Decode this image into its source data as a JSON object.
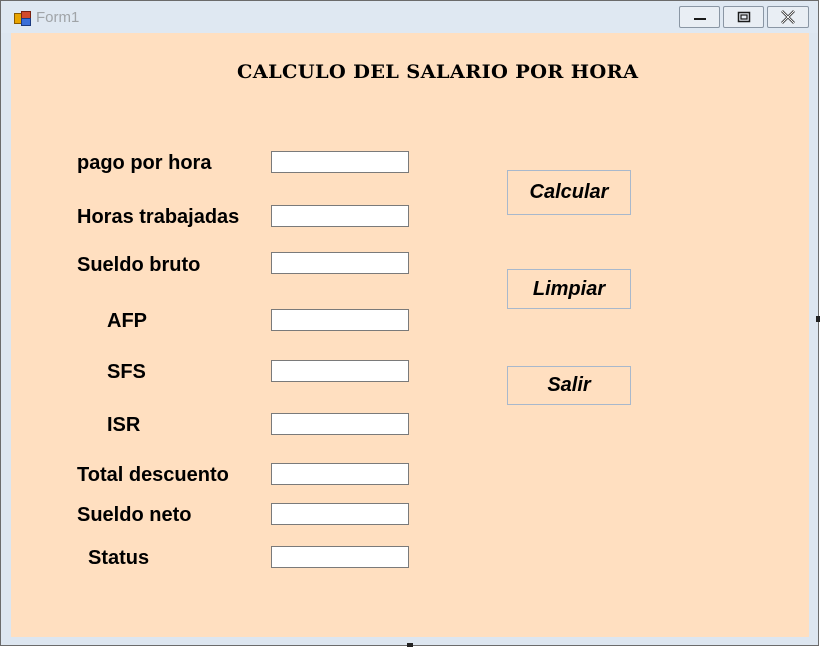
{
  "window": {
    "title": "Form1",
    "controls": {
      "minimize": "minimize",
      "maximize": "maximize",
      "close": "close"
    }
  },
  "form": {
    "heading": "CALCULO DEL SALARIO POR HORA",
    "background": "#ffdfc0",
    "fields": [
      {
        "label": "pago por hora",
        "value": ""
      },
      {
        "label": "Horas trabajadas",
        "value": ""
      },
      {
        "label": "Sueldo bruto",
        "value": ""
      },
      {
        "label": "AFP",
        "value": ""
      },
      {
        "label": "SFS",
        "value": ""
      },
      {
        "label": "ISR",
        "value": ""
      },
      {
        "label": "Total descuento",
        "value": ""
      },
      {
        "label": "Sueldo neto",
        "value": ""
      },
      {
        "label": "Status",
        "value": ""
      }
    ],
    "buttons": {
      "calcular": "Calcular",
      "limpiar": "Limpiar",
      "salir": "Salir"
    }
  }
}
